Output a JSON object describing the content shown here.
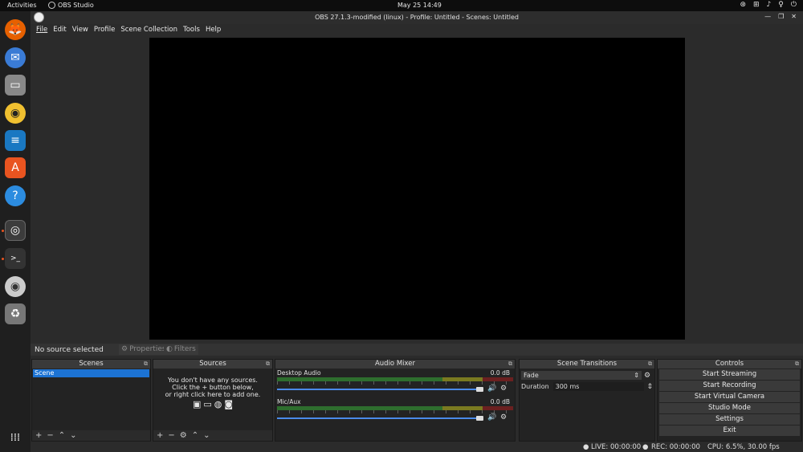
{
  "topbar": {
    "activities": "Activities",
    "app_name": "OBS Studio",
    "clock": "May 25  14:49"
  },
  "window": {
    "title": "OBS 27.1.3-modified (linux) - Profile: Untitled - Scenes: Untitled",
    "menu": [
      "File",
      "Edit",
      "View",
      "Profile",
      "Scene Collection",
      "Tools",
      "Help"
    ]
  },
  "source_bar": {
    "no_source": "No source selected",
    "properties": "Properties",
    "filters": "Filters"
  },
  "scenes": {
    "title": "Scenes",
    "items": [
      "Scene"
    ]
  },
  "sources": {
    "title": "Sources",
    "empty_line1": "You don't have any sources.",
    "empty_line2": "Click the + button below,",
    "empty_line3": "or right click here to add one."
  },
  "mixer": {
    "title": "Audio Mixer",
    "channels": [
      {
        "name": "Desktop Audio",
        "db": "0.0 dB",
        "level": 1.0
      },
      {
        "name": "Mic/Aux",
        "db": "0.0 dB",
        "level": 1.0
      }
    ]
  },
  "transitions": {
    "title": "Scene Transitions",
    "selected": "Fade",
    "duration_label": "Duration",
    "duration_value": "300 ms"
  },
  "controls": {
    "title": "Controls",
    "buttons": [
      "Start Streaming",
      "Start Recording",
      "Start Virtual Camera",
      "Studio Mode",
      "Settings",
      "Exit"
    ]
  },
  "status": {
    "live": "LIVE: 00:00:00",
    "rec": "REC: 00:00:00",
    "cpu": "CPU: 6.5%, 30.00 fps"
  },
  "colors": {
    "accent": "#1c73d3",
    "fader": "#4a8ae8",
    "ubuntu": "#e95420"
  }
}
